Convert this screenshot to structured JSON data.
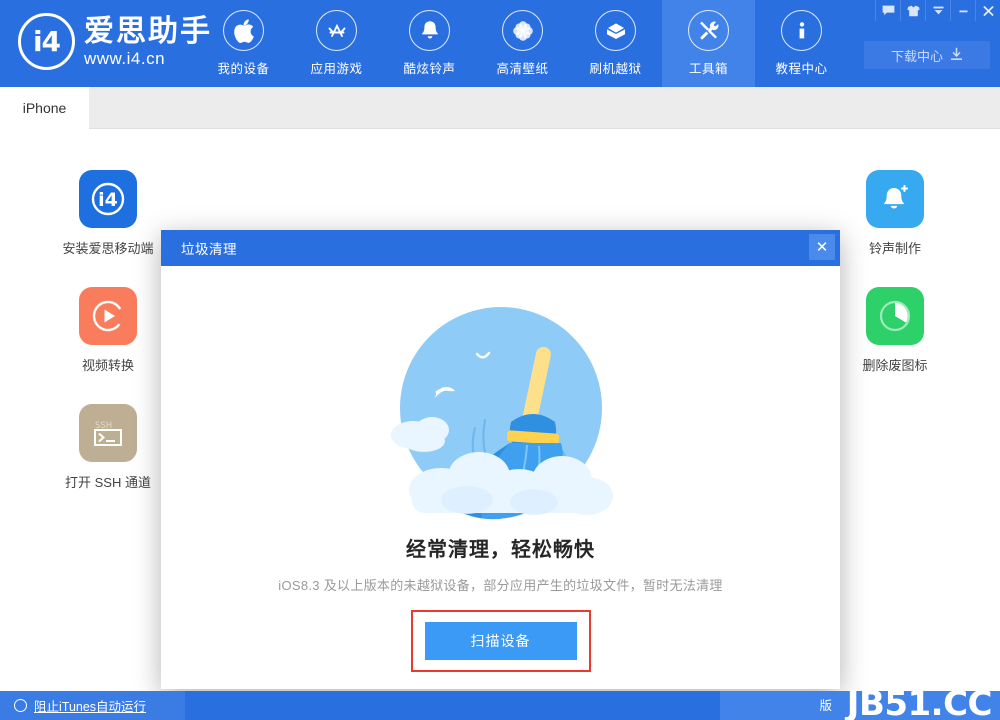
{
  "brand": {
    "logo_mark": "i4",
    "name": "爱思助手",
    "site": "www.i4.cn"
  },
  "header": {
    "nav": [
      {
        "label": "我的设备",
        "icon": "apple-icon",
        "active": false
      },
      {
        "label": "应用游戏",
        "icon": "appstore-icon",
        "active": false
      },
      {
        "label": "酷炫铃声",
        "icon": "bell-icon",
        "active": false
      },
      {
        "label": "高清壁纸",
        "icon": "flower-icon",
        "active": false
      },
      {
        "label": "刷机越狱",
        "icon": "open-box-icon",
        "active": false
      },
      {
        "label": "工具箱",
        "icon": "tools-icon",
        "active": true
      },
      {
        "label": "教程中心",
        "icon": "info-icon",
        "active": false
      }
    ],
    "window_buttons": [
      {
        "name": "feedback-icon",
        "glyph": "▬"
      },
      {
        "name": "skin-shirt-icon",
        "glyph": "▼"
      },
      {
        "name": "chevron-down-icon",
        "glyph": "▼"
      },
      {
        "name": "minimize-icon",
        "glyph": "–"
      },
      {
        "name": "close-icon",
        "glyph": "✕"
      }
    ],
    "download_center": {
      "label": "下载中心",
      "icon": "download-icon"
    }
  },
  "tabs": {
    "active": "iPhone"
  },
  "tools": {
    "left": [
      {
        "label": "安装爱思移动端",
        "icon": "i4-app-icon",
        "color": "#1e6fe0"
      },
      {
        "label": "视频转换",
        "icon": "video-play-icon",
        "color": "#f97d5d"
      },
      {
        "label": "打开 SSH 通道",
        "icon": "ssh-terminal-icon",
        "color": "#bdae94"
      }
    ],
    "right": [
      {
        "label": "铃声制作",
        "icon": "ringtone-bell-icon",
        "color": "#37a9f0"
      },
      {
        "label": "删除废图标",
        "icon": "pie-clock-icon",
        "color": "#2ed06a"
      }
    ]
  },
  "modal": {
    "title": "垃圾清理",
    "close_glyph": "✕",
    "illustration": "broom-clouds-birds",
    "hero_title": "经常清理，轻松畅快",
    "hero_sub": "iOS8.3 及以上版本的未越狱设备，部分应用产生的垃圾文件，暂时无法清理",
    "scan_button": "扫描设备",
    "highlight_color": "#e83b2e",
    "button_color": "#3a9af5"
  },
  "statusbar": {
    "block_itunes_label": "阻止iTunes自动运行",
    "copyright": "版",
    "watermark": "JB51.CC"
  },
  "colors": {
    "header_blue": "#2a6fe0",
    "active_nav_blue": "#4183e8",
    "accent_blue": "#3a9af5"
  }
}
